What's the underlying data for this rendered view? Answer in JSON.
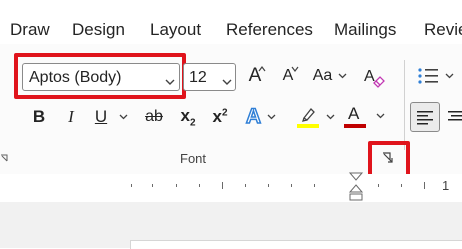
{
  "tabs": [
    {
      "label": "Draw"
    },
    {
      "label": "Design"
    },
    {
      "label": "Layout"
    },
    {
      "label": "References"
    },
    {
      "label": "Mailings"
    },
    {
      "label": "Revie"
    }
  ],
  "font": {
    "name": "Aptos (Body)",
    "size": "12",
    "grow_label": "A",
    "shrink_label": "A",
    "case_label": "Aa",
    "bold": "B",
    "italic": "I",
    "underline": "U",
    "strikethrough": "ab",
    "subscript_base": "x",
    "subscript_mark": "2",
    "superscript_base": "x",
    "superscript_mark": "2",
    "text_effects": "A",
    "font_color_label": "A",
    "group_label": "Font"
  },
  "colors": {
    "highlight_box": "#e0141c",
    "highlighter": "#ffff00",
    "font_color": "#c00000",
    "text_effects": "#2f7fd6"
  },
  "ruler": {
    "number": "1"
  }
}
